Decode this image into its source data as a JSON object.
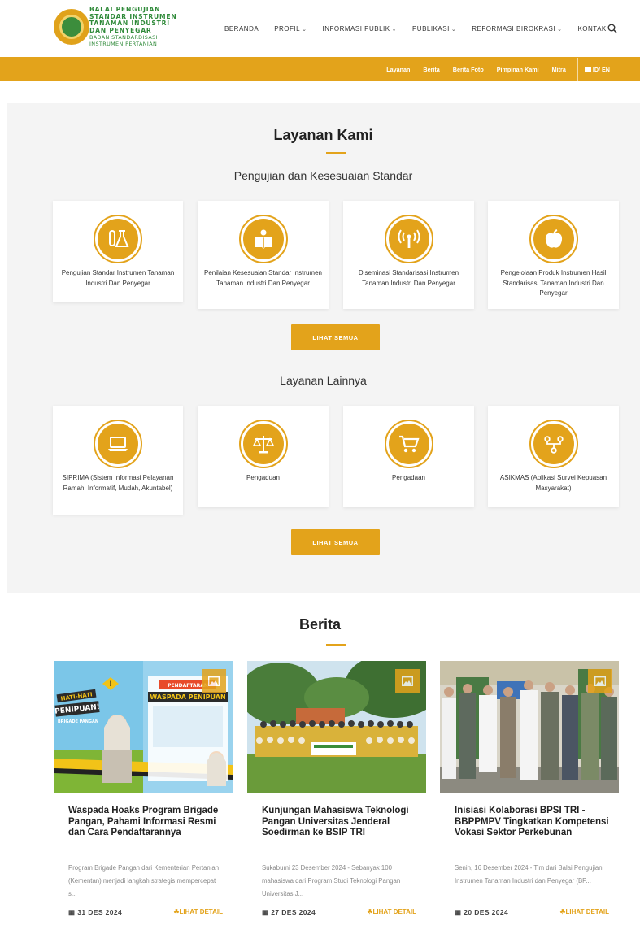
{
  "brand": {
    "line1": "BALAI PENGUJIAN",
    "line2": "STANDAR INSTRUMEN",
    "line3": "TANAMAN INDUSTRI",
    "line4": "DAN PENYEGAR",
    "line5": "BADAN STANDARDISASI",
    "line6": "INSTRUMEN PERTANIAN"
  },
  "nav": {
    "items": [
      {
        "label": "BERANDA"
      },
      {
        "label": "PROFIL"
      },
      {
        "label": "INFORMASI PUBLIK"
      },
      {
        "label": "PUBLIKASI"
      },
      {
        "label": "REFORMASI BIROKRASI"
      },
      {
        "label": "KONTAK"
      }
    ]
  },
  "subnav": {
    "items": [
      {
        "label": "Layanan"
      },
      {
        "label": "Berita"
      },
      {
        "label": "Berita Foto"
      },
      {
        "label": "Pimpinan Kami"
      },
      {
        "label": "Mitra"
      }
    ],
    "lang": "ID/ EN"
  },
  "services": {
    "title": "Layanan Kami",
    "group1_title": "Pengujian dan Kesesuaian Standar",
    "group1": [
      {
        "label": "Pengujian Standar Instrumen Tanaman Industri Dan Penyegar",
        "icon": "flask-icon"
      },
      {
        "label": "Penilaian Kesesuaian Standar Instrumen Tanaman Industri Dan Penyegar",
        "icon": "reading-icon"
      },
      {
        "label": "Diseminasi Standarisasi Instrumen Tanaman Industri Dan Penyegar",
        "icon": "antenna-icon"
      },
      {
        "label": "Pengelolaan Produk Instrumen Hasil Standarisasi Tanaman Industri Dan Penyegar",
        "icon": "apple-icon"
      }
    ],
    "button1": "LIHAT SEMUA",
    "group2_title": "Layanan Lainnya",
    "group2": [
      {
        "label": "SIPRIMA (Sistem Informasi Pelayanan Ramah, Informatif, Mudah, Akuntabel)",
        "icon": "laptop-icon"
      },
      {
        "label": "Pengaduan",
        "icon": "scale-icon"
      },
      {
        "label": "Pengadaan",
        "icon": "cart-icon"
      },
      {
        "label": "ASIKMAS (Aplikasi Survei Kepuasan Masyarakat)",
        "icon": "network-icon"
      }
    ],
    "button2": "LIHAT SEMUA"
  },
  "news": {
    "title": "Berita",
    "items": [
      {
        "headline": "Waspada Hoaks Program Brigade Pangan, Pahami Informasi Resmi dan Cara Pendaftarannya",
        "excerpt": "Program Brigade Pangan dari Kementerian Pertanian (Kementan) menjadi langkah strategis mempercepat s...",
        "date": "31 DES 2024",
        "more": "LIHAT DETAIL"
      },
      {
        "headline": "Kunjungan Mahasiswa Teknologi Pangan Universitas Jenderal Soedirman ke BSIP TRI",
        "excerpt": "Sukabumi 23 Desember 2024 - Sebanyak 100 mahasiswa dari Program Studi Teknologi Pangan Universitas J...",
        "date": "27 DES 2024",
        "more": "LIHAT DETAIL"
      },
      {
        "headline": "Inisiasi Kolaborasi BPSI TRI - BBPPMPV Tingkatkan Kompetensi Vokasi Sektor Perkebunan",
        "excerpt": "Senin, 16 Desember 2024 - Tim dari Balai Pengujian Instrumen Tanaman Industri dan Penyegar (BP...",
        "date": "20 DES 2024",
        "more": "LIHAT DETAIL"
      }
    ],
    "poster_text": {
      "hati": "HATI-HATI",
      "penipuan": "PENIPUAN!",
      "brigade": "BRIGADE PANGAN",
      "pendaftaran": "PENDAFTARAN",
      "waspada": "WASPADA PENIPUAN"
    }
  },
  "colors": {
    "accent": "#e3a31b",
    "brand_green": "#2f8a39"
  }
}
